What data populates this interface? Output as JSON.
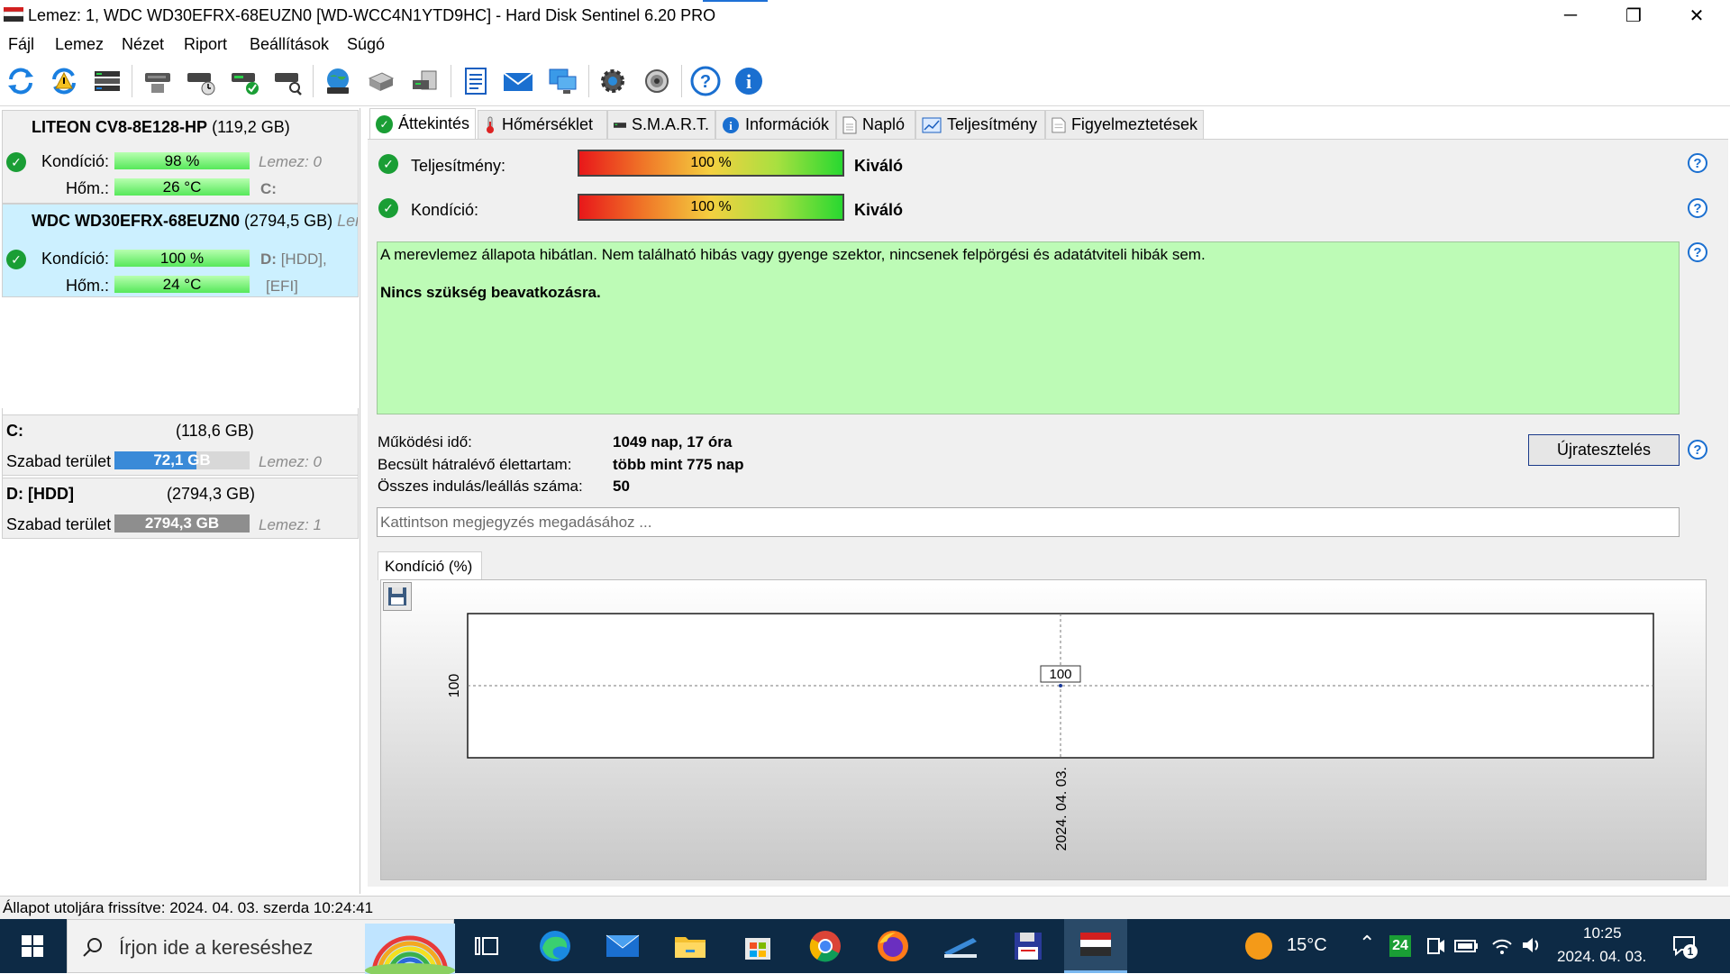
{
  "window": {
    "title": "Lemez: 1, WDC WD30EFRX-68EUZN0 [WD-WCC4N1YTD9HC]  -  Hard Disk Sentinel 6.20 PRO",
    "minimize": "─",
    "restore": "❐",
    "close": "✕"
  },
  "menu": {
    "items": [
      "Fájl",
      "Lemez",
      "Nézet",
      "Riport",
      "Beállítások",
      "Súgó"
    ]
  },
  "toolbar": {
    "icons": [
      "refresh-icon",
      "refresh-warning-icon",
      "disk-list-icon",
      "disk-info-icon",
      "disk-schedule-icon",
      "disk-check-icon",
      "disk-search-icon",
      "globe-disk-icon",
      "disk-network-icon",
      "disk-backup-icon",
      "report-icon",
      "email-icon",
      "network-icon",
      "gear-icon",
      "sound-icon",
      "help-icon",
      "info-icon"
    ]
  },
  "disks": [
    {
      "name": "LITEON CV8-8E128-HP",
      "size": "(119,2 GB)",
      "condition_label": "Kondíció:",
      "condition_value": "98 %",
      "condition_fraction": 0.98,
      "temp_label": "Hőm.:",
      "temp_value": "26 °C",
      "disk_index": "Lemez: 0",
      "volumes": "C:",
      "volumes_extra": ""
    },
    {
      "name": "WDC WD30EFRX-68EUZN0",
      "size": "(2794,5 GB)",
      "disk_index_trunc": "Lem",
      "condition_label": "Kondíció:",
      "condition_value": "100 %",
      "condition_fraction": 1.0,
      "temp_label": "Hőm.:",
      "temp_value": "24 °C",
      "volumes": "D:",
      "volumes_rest": "[HDD],",
      "volumes_extra": "[EFI]"
    }
  ],
  "volumes": [
    {
      "name": "C:",
      "size": "(118,6 GB)",
      "free_label": "Szabad terület",
      "free_value": "72,1 GB",
      "disk_index": "Lemez: 0",
      "bar_color": "#3a8ad8"
    },
    {
      "name": "D: [HDD]",
      "size": "(2794,3 GB)",
      "free_label": "Szabad terület",
      "free_value": "2794,3 GB",
      "disk_index": "Lemez: 1",
      "bar_color": "#8e8e8e"
    }
  ],
  "tabs": [
    {
      "label": "Áttekintés",
      "icon": "check-icon"
    },
    {
      "label": "Hőmérséklet",
      "icon": "thermometer-icon"
    },
    {
      "label": "S.M.A.R.T.",
      "icon": "disk-icon"
    },
    {
      "label": "Információk",
      "icon": "info-icon"
    },
    {
      "label": "Napló",
      "icon": "document-icon"
    },
    {
      "label": "Teljesítmény",
      "icon": "performance-icon"
    },
    {
      "label": "Figyelmeztetések",
      "icon": "warnings-icon"
    }
  ],
  "overview": {
    "performance_label": "Teljesítmény:",
    "performance_value": "100 %",
    "performance_fraction": 1.0,
    "performance_rating": "Kiváló",
    "condition_label": "Kondíció:",
    "condition_value": "100 %",
    "condition_fraction": 1.0,
    "condition_rating": "Kiváló",
    "status_text": "A merevlemez állapota hibátlan. Nem található hibás vagy gyenge szektor, nincsenek felpörgési és adatátviteli hibák sem.",
    "status_action": "Nincs szükség beavatkozásra.",
    "status_color": "#bdfbb6",
    "uptime_label": "Működési idő:",
    "uptime_value": "1049 nap, 17 óra",
    "lifetime_label": "Becsült hátralévő élettartam:",
    "lifetime_value": "több mint 775 nap",
    "starts_label": "Összes indulás/leállás száma:",
    "starts_value": "50",
    "retest_button": "Újratesztelés",
    "note_placeholder": "Kattintson megjegyzés megadásához ..."
  },
  "chart_data": {
    "type": "line",
    "title": "Kondíció  (%)",
    "x": [
      "2024. 04. 03."
    ],
    "series": [
      {
        "values": [
          100
        ]
      }
    ],
    "ytick": "100",
    "data_label": "100"
  },
  "statusbar": {
    "text": "Állapot utoljára frissítve: 2024. 04. 03. szerda 10:24:41"
  },
  "taskbar": {
    "search_placeholder": "Írjon ide a kereséshez",
    "weather": "15°C",
    "time": "10:25",
    "date": "2024. 04. 03.",
    "notifications": "1",
    "tray_badge": "24"
  }
}
